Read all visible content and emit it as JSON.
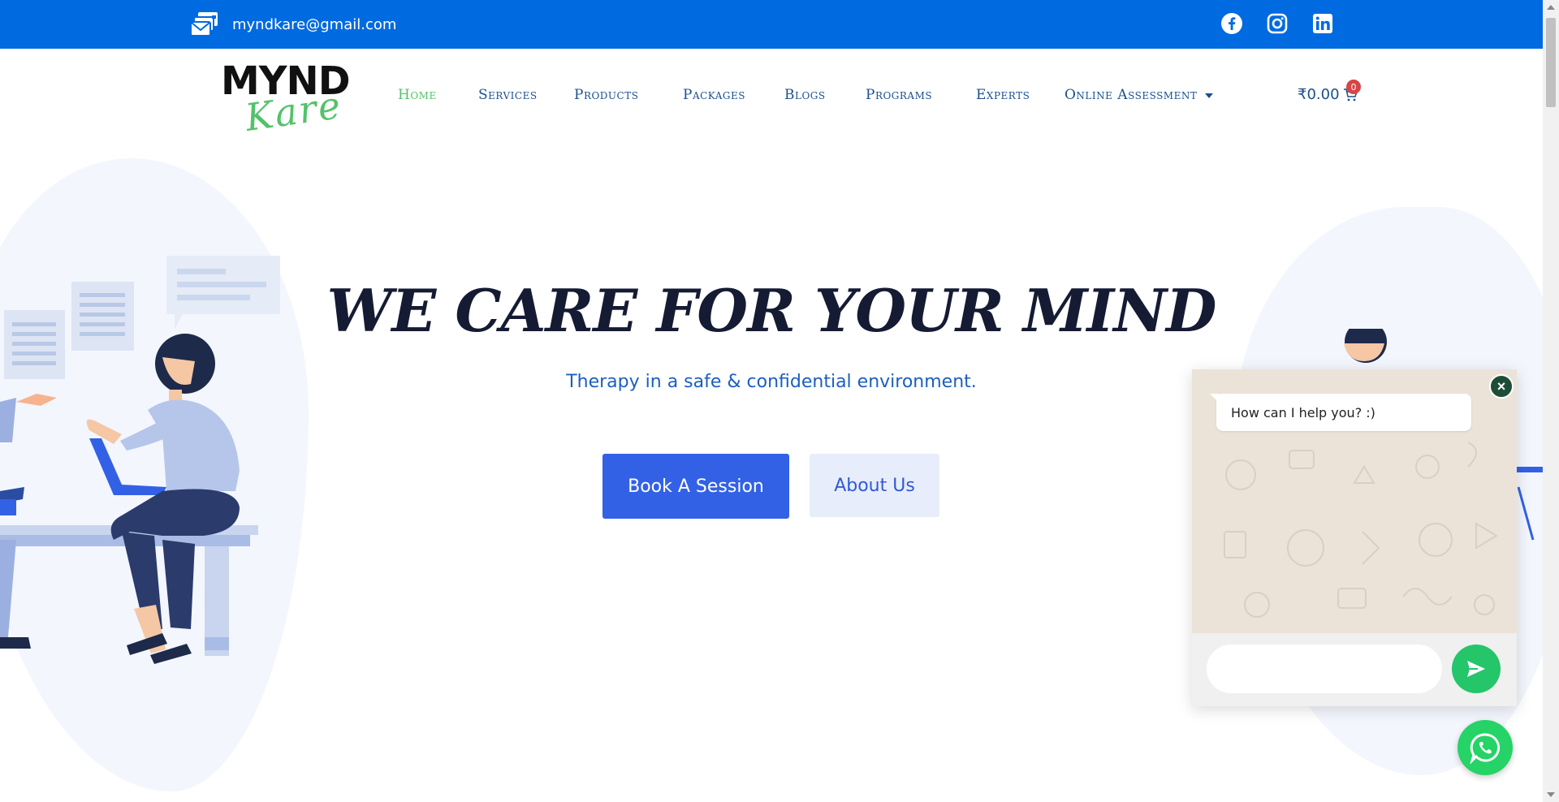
{
  "topbar": {
    "email": "myndkare@gmail.com",
    "email_icon": "mail-stack-icon",
    "social": [
      {
        "name": "facebook-icon"
      },
      {
        "name": "instagram-icon"
      },
      {
        "name": "linkedin-icon"
      }
    ]
  },
  "logo": {
    "line1": "MYND",
    "line2": "Kare"
  },
  "nav": {
    "items": [
      {
        "label": "Home",
        "active": true
      },
      {
        "label": "Services"
      },
      {
        "label": "Products"
      },
      {
        "label": "Packages"
      },
      {
        "label": "Blogs"
      },
      {
        "label": "Programs"
      },
      {
        "label": "Experts"
      },
      {
        "label": "Online Assessment",
        "dropdown": true
      }
    ]
  },
  "cart": {
    "total": "₹0.00",
    "count": "0"
  },
  "hero": {
    "title": "WE CARE FOR YOUR MIND",
    "subtitle": "Therapy in a safe & confidential environment.",
    "primary_button": "Book A Session",
    "secondary_button": "About Us"
  },
  "chat": {
    "message": "How can I help you? :)",
    "input_placeholder": ""
  },
  "colors": {
    "topbar": "#006ae0",
    "nav_text": "#1b4f8f",
    "nav_active": "#53c26a",
    "primary": "#3361e6",
    "whatsapp": "#25d366"
  }
}
